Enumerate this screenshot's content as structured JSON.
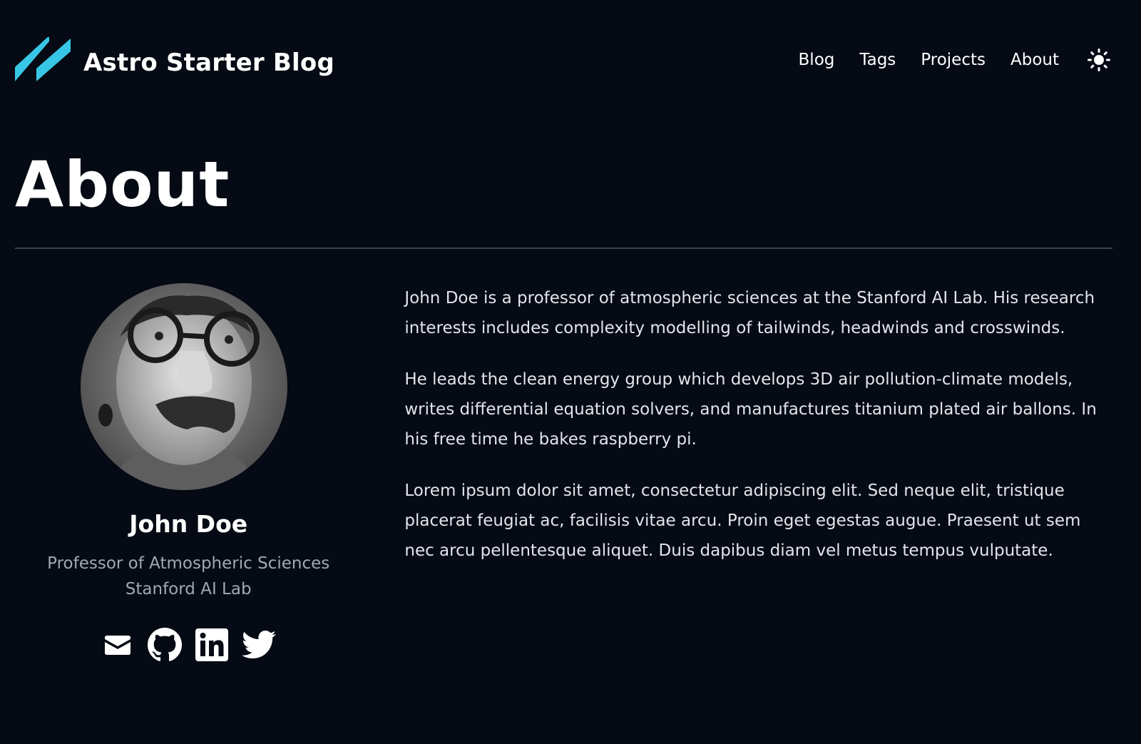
{
  "header": {
    "title": "Astro Starter Blog",
    "logo_icon": "astro-logo-icon",
    "nav": [
      {
        "label": "Blog"
      },
      {
        "label": "Tags"
      },
      {
        "label": "Projects"
      },
      {
        "label": "About"
      }
    ],
    "theme_toggle_icon": "sun-icon"
  },
  "page": {
    "title": "About"
  },
  "profile": {
    "name": "John Doe",
    "occupation": "Professor of Atmospheric Sciences",
    "company": "Stanford AI Lab",
    "socials": [
      {
        "icon": "mail-icon"
      },
      {
        "icon": "github-icon"
      },
      {
        "icon": "linkedin-icon"
      },
      {
        "icon": "twitter-icon"
      }
    ]
  },
  "bio": {
    "paragraphs": [
      "John Doe is a professor of atmospheric sciences at the Stanford AI Lab. His research interests includes complexity modelling of tailwinds, headwinds and crosswinds.",
      "He leads the clean energy group which develops 3D air pollution-climate models, writes differential equation solvers, and manufactures titanium plated air ballons. In his free time he bakes raspberry pi.",
      "Lorem ipsum dolor sit amet, consectetur adipiscing elit. Sed neque elit, tristique placerat feugiat ac, facilisis vitae arcu. Proin eget egestas augue. Praesent ut sem nec arcu pellentesque aliquet. Duis dapibus diam vel metus tempus vulputate."
    ]
  },
  "colors": {
    "background": "#050a14",
    "accent": "#38bdf8",
    "text": "#ffffff",
    "muted": "#a3a8b0",
    "divider": "#3a4250"
  }
}
